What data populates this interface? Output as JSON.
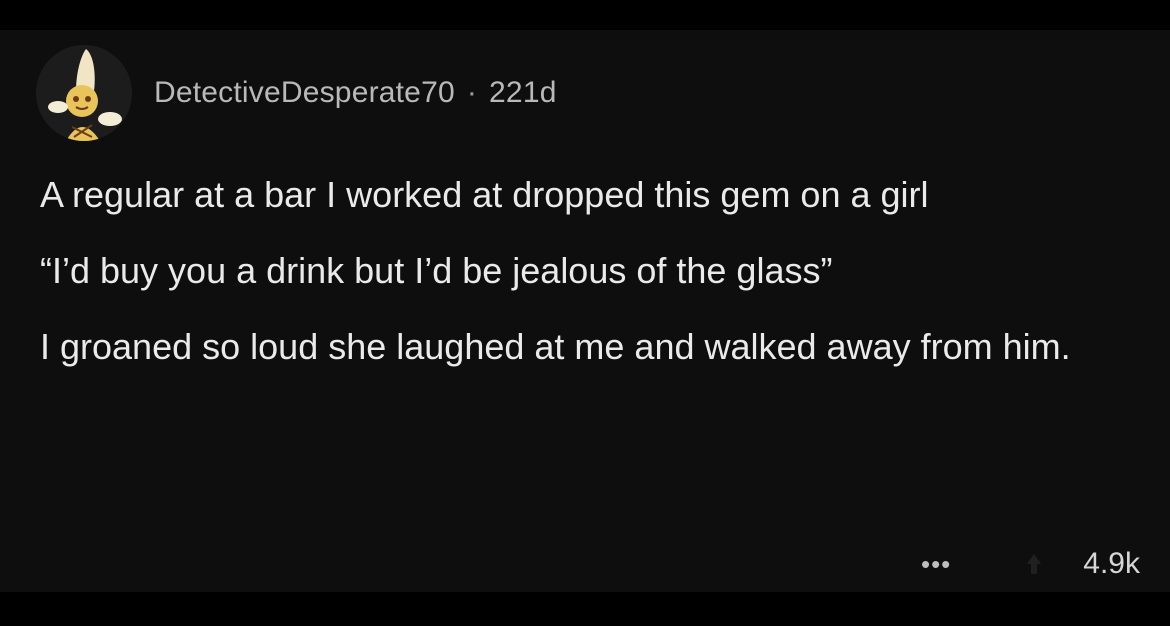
{
  "post": {
    "author": "DetectiveDesperate70",
    "separator": "·",
    "age": "221d",
    "paragraphs": [
      "A regular at a bar I worked at dropped this gem on a girl",
      "“I’d buy you a drink but I’d be jealous of the glass”",
      "I groaned so loud she laughed at me and walked away from him."
    ],
    "more_label": "•••",
    "score": "4.9k"
  },
  "colors": {
    "background": "#0e0e0e",
    "text": "#eaeaea",
    "meta": "#b9b9b9",
    "avatar_accent": "#e9c45a"
  },
  "icons": {
    "avatar": "snoo-avatar-icon",
    "more": "more-options-icon",
    "vote": "upvote-icon"
  }
}
